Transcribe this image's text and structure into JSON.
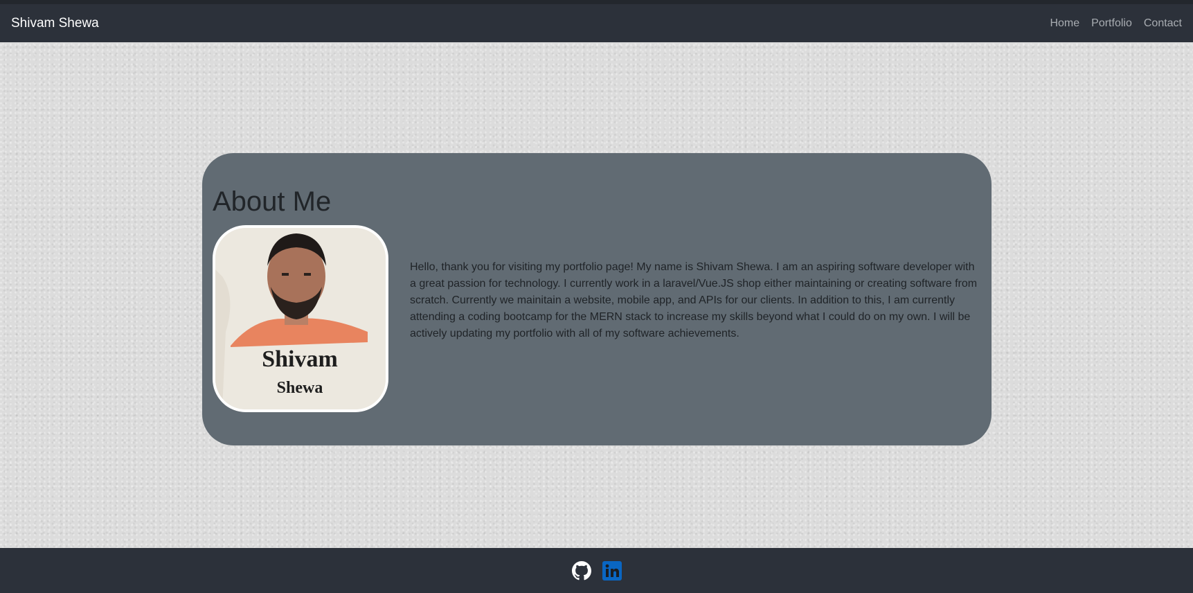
{
  "navbar": {
    "brand": "Shivam Shewa",
    "links": [
      {
        "label": "Home"
      },
      {
        "label": "Portfolio"
      },
      {
        "label": "Contact"
      }
    ]
  },
  "about": {
    "title": "About Me",
    "photo_caption_line1": "Shivam",
    "photo_caption_line2": "Shewa",
    "text": "Hello, thank you for visiting my portfolio page! My name is Shivam Shewa. I am an aspiring software developer with a great passion for technology. I currently work in a laravel/Vue.JS shop either maintaining or creating software from scratch. Currently we mainitain a website, mobile app, and APIs for our clients. In addition to this, I am currently attending a coding bootcamp for the MERN stack to increase my skills beyond what I could do on my own. I will be actively updating my portfolio with all of my software achievements."
  },
  "footer": {
    "icons": [
      "github-icon",
      "linkedin-icon"
    ],
    "linkedin_color": "#0a66c2"
  },
  "colors": {
    "navbar_bg": "#2c313a",
    "card_bg": "#616b73",
    "page_bg": "#dcdcdc"
  }
}
